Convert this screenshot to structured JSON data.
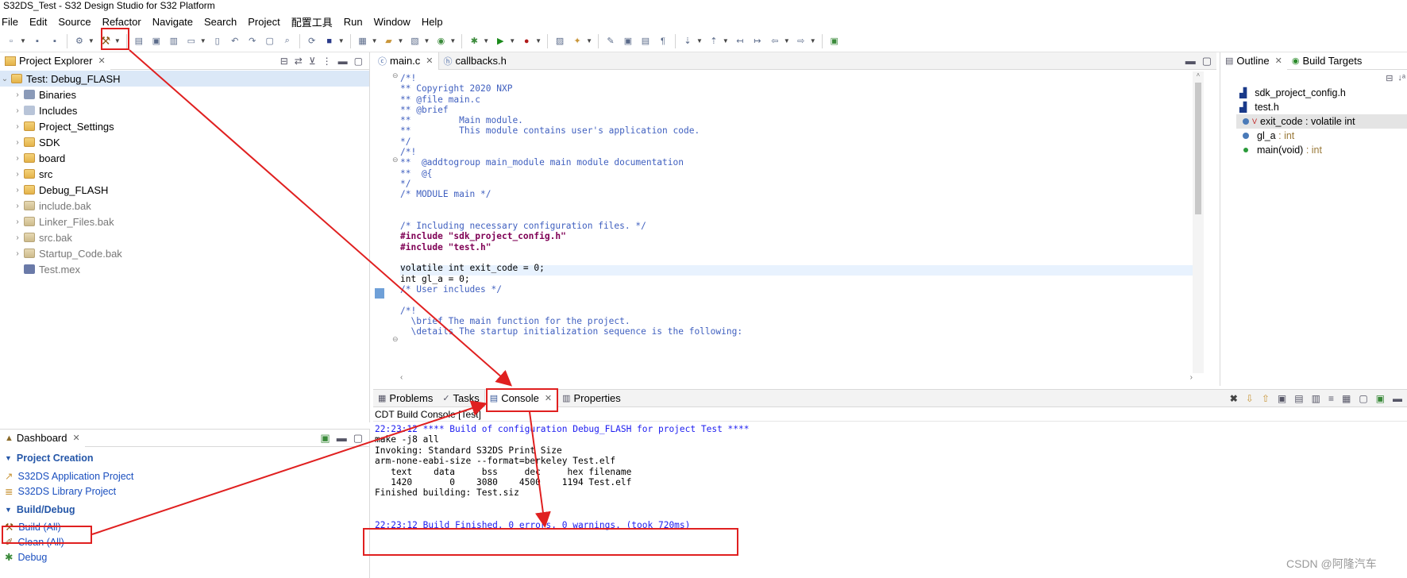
{
  "window": {
    "title": "S32DS_Test - S32 Design Studio for S32 Platform"
  },
  "menu": [
    "File",
    "Edit",
    "Source",
    "Refactor",
    "Navigate",
    "Search",
    "Project",
    "配置工具",
    "Run",
    "Window",
    "Help"
  ],
  "project_explorer": {
    "title": "Project Explorer",
    "root": "Test: Debug_FLASH",
    "items": [
      {
        "label": "Binaries",
        "muted": false
      },
      {
        "label": "Includes",
        "muted": false
      },
      {
        "label": "Project_Settings",
        "muted": false
      },
      {
        "label": "SDK",
        "muted": false
      },
      {
        "label": "board",
        "muted": false
      },
      {
        "label": "src",
        "muted": false
      },
      {
        "label": "Debug_FLASH",
        "muted": false
      },
      {
        "label": "include.bak",
        "muted": true
      },
      {
        "label": "Linker_Files.bak",
        "muted": true
      },
      {
        "label": "src.bak",
        "muted": true
      },
      {
        "label": "Startup_Code.bak",
        "muted": true
      },
      {
        "label": "Test.mex",
        "muted": true
      }
    ]
  },
  "editor": {
    "tabs": [
      {
        "label": "main.c",
        "active": true
      },
      {
        "label": "callbacks.h",
        "active": false
      }
    ],
    "lines": [
      "/*!",
      "** Copyright 2020 NXP",
      "** @file main.c",
      "** @brief",
      "**         Main module.",
      "**         This module contains user's application code.",
      "*/",
      "/*!",
      "**  @addtogroup main_module main module documentation",
      "**  @{",
      "*/",
      "/* MODULE main */",
      "",
      "",
      "/* Including necessary configuration files. */",
      "#include \"sdk_project_config.h\"",
      "#include \"test.h\"",
      "",
      "volatile int exit_code = 0;",
      "int gl_a = 0;",
      "/* User includes */",
      "",
      "/*!",
      "  \\brief The main function for the project.",
      "  \\details The startup initialization sequence is the following:"
    ]
  },
  "outline": {
    "tabs": [
      "Outline",
      "Build Targets"
    ],
    "items": [
      {
        "label": "sdk_project_config.h",
        "type": ""
      },
      {
        "label": "test.h",
        "type": ""
      },
      {
        "label": "exit_code",
        "type": "volatile int"
      },
      {
        "label": "gl_a",
        "type": "int"
      },
      {
        "label": "main(void)",
        "type": "int"
      }
    ]
  },
  "bottom_tabs": [
    "Problems",
    "Tasks",
    "Console",
    "Properties"
  ],
  "console": {
    "header": "CDT Build Console [Test]",
    "lines": [
      "22:23:12 **** Build of configuration Debug_FLASH for project Test ****",
      "make -j8 all",
      "Invoking: Standard S32DS Print Size",
      "arm-none-eabi-size --format=berkeley Test.elf",
      "   text    data     bss     dec     hex filename",
      "   1420       0    3080    4500    1194 Test.elf",
      "Finished building: Test.siz",
      "",
      "",
      "22:23:12 Build Finished. 0 errors, 0 warnings. (took 720ms)"
    ]
  },
  "dashboard": {
    "title": "Dashboard",
    "sections": [
      {
        "title": "Project Creation",
        "items": [
          "S32DS Application Project",
          "S32DS Library Project"
        ]
      },
      {
        "title": "Build/Debug",
        "items": [
          "Build  (All)",
          "Clean  (All)",
          "Debug"
        ]
      }
    ]
  },
  "watermark": "CSDN @阿隆汽车",
  "colors": {
    "annotation": "#e02020",
    "link": "#1a4fbf",
    "keyword": "#7f0055",
    "comment": "#3f5fbf",
    "string": "#2a00ff"
  }
}
